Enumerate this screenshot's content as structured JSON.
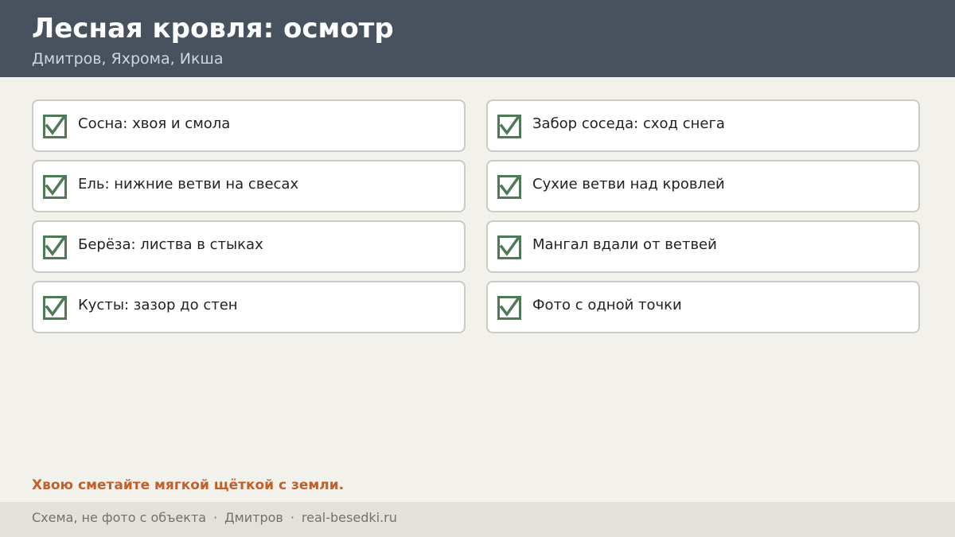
{
  "header": {
    "title": "Лесная кровля: осмотр",
    "subtitle": "Дмитров, Яхрома, Икша"
  },
  "checklist": {
    "checkbox_icon": "checkmark-icon",
    "check_color": "#4e7a57",
    "items": [
      {
        "label": "Сосна: хвоя и смола",
        "checked": true
      },
      {
        "label": "Забор соседа: сход снега",
        "checked": true
      },
      {
        "label": "Ель: нижние ветви на свесах",
        "checked": true
      },
      {
        "label": "Сухие ветви над кровлей",
        "checked": true
      },
      {
        "label": "Берёза: листва в стыках",
        "checked": true
      },
      {
        "label": "Мангал вдали от ветвей",
        "checked": true
      },
      {
        "label": "Кусты: зазор до стен",
        "checked": true
      },
      {
        "label": "Фото с одной точки",
        "checked": true
      }
    ]
  },
  "tip": {
    "text": "Хвою сметайте мягкой щёткой с земли.",
    "color": "#c0602a"
  },
  "footer": {
    "note": "Схема, не фото с объекта",
    "city": "Дмитров",
    "site": "real-besedki.ru",
    "separator": "·"
  },
  "colors": {
    "header_bg": "#48525e",
    "page_bg": "#f3f1ec",
    "footer_bg": "#e4e1da"
  }
}
